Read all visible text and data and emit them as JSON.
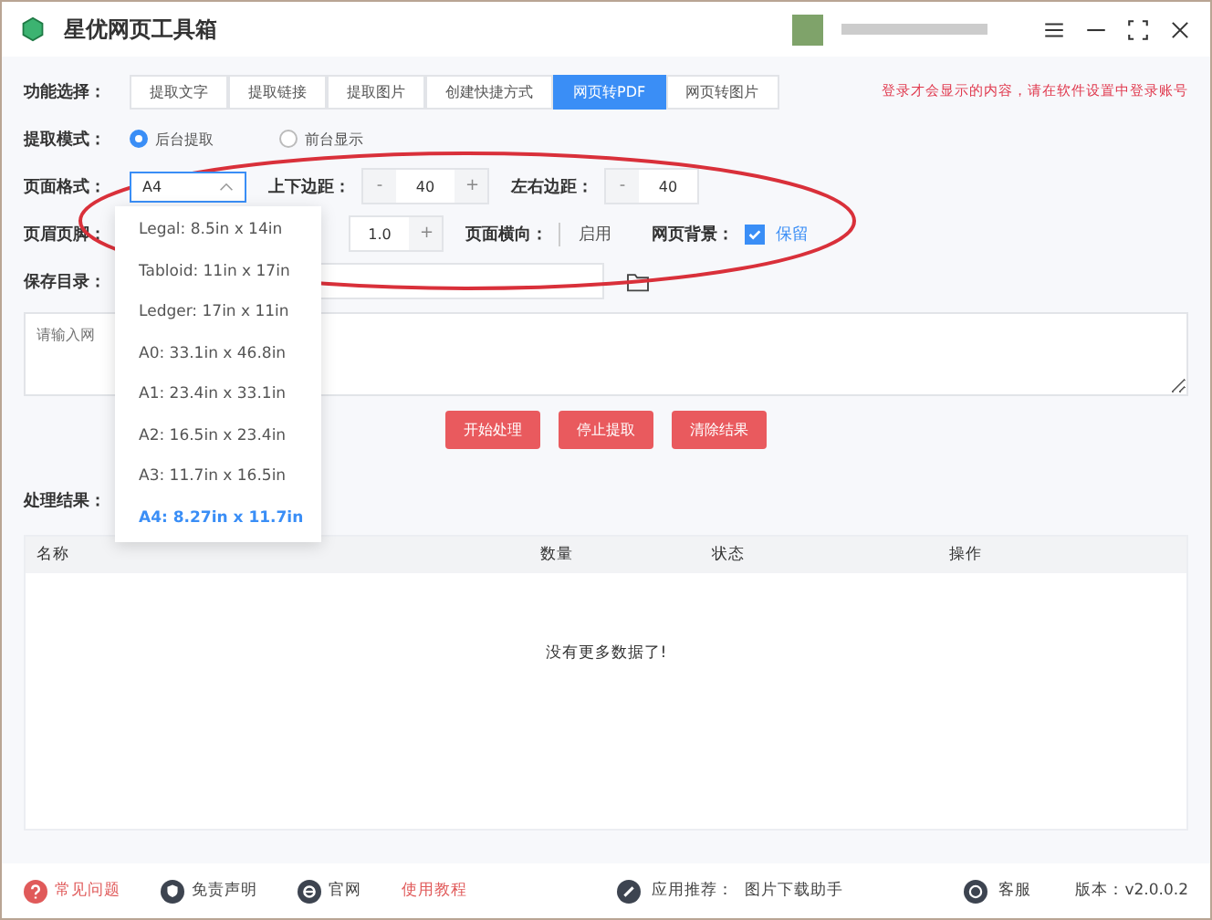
{
  "window": {
    "title": "星优网页工具箱"
  },
  "notice": "登录才会显示的内容，请在软件设置中登录账号",
  "function_select": {
    "label": "功能选择：",
    "tabs": [
      {
        "label": "提取文字",
        "selected": false
      },
      {
        "label": "提取链接",
        "selected": false
      },
      {
        "label": "提取图片",
        "selected": false
      },
      {
        "label": "创建快捷方式",
        "selected": false
      },
      {
        "label": "网页转PDF",
        "selected": true
      },
      {
        "label": "网页转图片",
        "selected": false
      }
    ]
  },
  "extract_mode": {
    "label": "提取模式：",
    "options": [
      {
        "label": "后台提取",
        "selected": true
      },
      {
        "label": "前台显示",
        "selected": false
      }
    ]
  },
  "page_format": {
    "label": "页面格式：",
    "value": "A4",
    "expanded": true,
    "options": [
      {
        "label": "Legal: 8.5in x 14in",
        "selected": false
      },
      {
        "label": "Tabloid: 11in x 17in",
        "selected": false
      },
      {
        "label": "Ledger: 17in x 11in",
        "selected": false
      },
      {
        "label": "A0: 33.1in x 46.8in",
        "selected": false
      },
      {
        "label": "A1: 23.4in x 33.1in",
        "selected": false
      },
      {
        "label": "A2: 16.5in x 23.4in",
        "selected": false
      },
      {
        "label": "A3: 11.7in x 16.5in",
        "selected": false
      },
      {
        "label": "A4: 8.27in x 11.7in",
        "selected": true
      }
    ]
  },
  "margin_tb": {
    "label": "上下边距：",
    "value": "40",
    "minus": "-",
    "plus": "+"
  },
  "margin_lr": {
    "label": "左右边距：",
    "value": "40",
    "minus": "-"
  },
  "header_footer": {
    "label": "页眉页脚：",
    "value": "1.0",
    "plus": "+"
  },
  "landscape": {
    "label": "页面横向：",
    "option": "启用",
    "checked": false
  },
  "background": {
    "label": "网页背景：",
    "option": "保留",
    "checked": true
  },
  "save_dir": {
    "label": "保存目录："
  },
  "url_input": {
    "placeholder": "请输入网"
  },
  "buttons": [
    "开始处理",
    "停止提取",
    "清除结果"
  ],
  "results": {
    "label": "处理结果：",
    "columns": [
      "名称",
      "数量",
      "状态",
      "操作"
    ],
    "empty": "没有更多数据了!"
  },
  "footer": {
    "left": [
      {
        "kind": "help",
        "label": "常见问题"
      },
      {
        "kind": "shield",
        "label": "免责声明"
      },
      {
        "kind": "web",
        "label": "官网"
      },
      {
        "kind": "plain",
        "label": "使用教程"
      }
    ],
    "recommend_label": "应用推荐：",
    "recommend_app": "图片下载助手",
    "service": "客服",
    "version": "版本：v2.0.0.2"
  }
}
